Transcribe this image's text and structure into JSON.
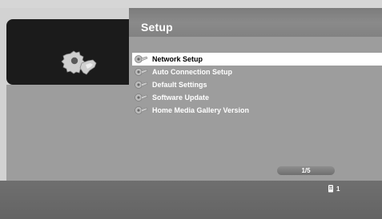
{
  "header": {
    "title": "Setup"
  },
  "menu": {
    "items": [
      {
        "label": "Network Setup",
        "selected": true
      },
      {
        "label": "Auto Connection Setup",
        "selected": false
      },
      {
        "label": "Default Settings",
        "selected": false
      },
      {
        "label": "Software Update",
        "selected": false
      },
      {
        "label": "Home Media Gallery Version",
        "selected": false
      }
    ]
  },
  "pager": {
    "text": "1/5"
  },
  "status": {
    "icon": "remote-icon",
    "value": "1"
  },
  "colors": {
    "accent": "#ffffff",
    "panel": "#9d9d9d",
    "header": "#848484",
    "footer": "#6b6b6b"
  }
}
